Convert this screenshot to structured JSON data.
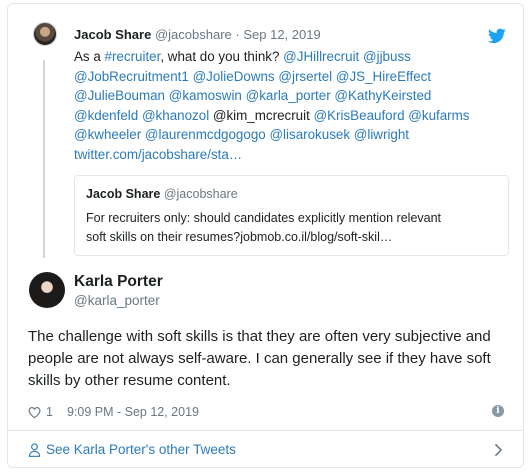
{
  "parent_tweet": {
    "author_name": "Jacob Share",
    "author_handle": "@jacobshare",
    "separator": "·",
    "date": "Sep 12, 2019",
    "text_lines": [
      [
        {
          "t": "As a ",
          "link": false
        },
        {
          "t": "#recruiter",
          "link": true
        },
        {
          "t": ", what do you think? ",
          "link": false
        },
        {
          "t": "@JHillrecruit",
          "link": true
        },
        {
          "t": " ",
          "link": false
        },
        {
          "t": "@jjbuss",
          "link": true
        }
      ],
      [
        {
          "t": "@JobRecruitment1",
          "link": true
        },
        {
          "t": " ",
          "link": false
        },
        {
          "t": "@JolieDowns",
          "link": true
        },
        {
          "t": " ",
          "link": false
        },
        {
          "t": "@jrsertel",
          "link": true
        },
        {
          "t": " ",
          "link": false
        },
        {
          "t": "@JS_HireEffect",
          "link": true
        }
      ],
      [
        {
          "t": "@JulieBouman",
          "link": true
        },
        {
          "t": " ",
          "link": false
        },
        {
          "t": "@kamoswin",
          "link": true
        },
        {
          "t": " ",
          "link": false
        },
        {
          "t": "@karla_porter",
          "link": true
        },
        {
          "t": " ",
          "link": false
        },
        {
          "t": "@KathyKeirsted",
          "link": true
        }
      ],
      [
        {
          "t": "@kdenfeld",
          "link": true
        },
        {
          "t": " ",
          "link": false
        },
        {
          "t": "@khanozol",
          "link": true
        },
        {
          "t": " @kim_mcrecruit ",
          "link": false
        },
        {
          "t": "@KrisBeauford",
          "link": true
        },
        {
          "t": " ",
          "link": false
        },
        {
          "t": "@kufarms",
          "link": true
        }
      ],
      [
        {
          "t": "@kwheeler",
          "link": true
        },
        {
          "t": " ",
          "link": false
        },
        {
          "t": "@laurenmcdgogogo",
          "link": true
        },
        {
          "t": " ",
          "link": false
        },
        {
          "t": "@lisarokusek",
          "link": true
        },
        {
          "t": " ",
          "link": false
        },
        {
          "t": "@liwright",
          "link": true
        }
      ],
      [
        {
          "t": "twitter.com/jacobshare/sta…",
          "link": true
        }
      ]
    ]
  },
  "quoted_tweet": {
    "author_name": "Jacob Share",
    "author_handle": "@jacobshare",
    "text_line1": "For recruiters only: should candidates explicitly mention relevant",
    "text_line2": "soft skills on their resumes?jobmob.co.il/blog/soft-skil…"
  },
  "main_tweet": {
    "author_name": "Karla Porter",
    "author_handle": "@karla_porter",
    "text": "The challenge with soft skills is that they are often very subjective and people are not always self-aware. I can generally see if they have soft skills by other resume content.",
    "likes": "1",
    "timestamp": "9:09 PM - Sep 12, 2019"
  },
  "footer": {
    "link_text": "See Karla Porter's other Tweets"
  },
  "icons": {
    "brand": "twitter-bird-icon",
    "like": "heart-icon",
    "info": "info-icon",
    "profile": "user-icon",
    "next": "chevron-right-icon"
  },
  "colors": {
    "link": "#2b7bb9",
    "muted": "#697882",
    "twitter_blue": "#1da1f2",
    "border": "#e1e8ed"
  }
}
